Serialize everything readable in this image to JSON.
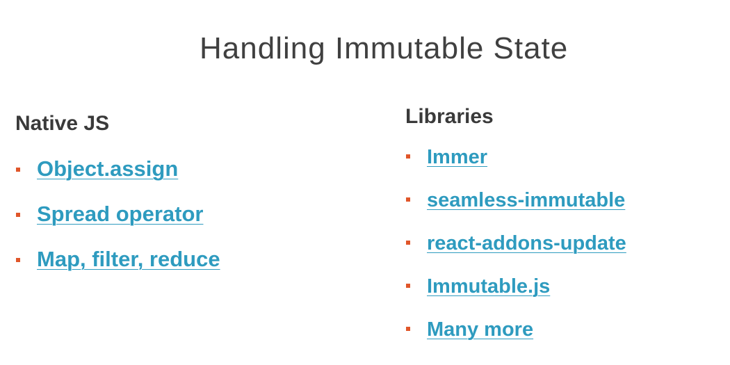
{
  "slide": {
    "title": "Handling Immutable State"
  },
  "native": {
    "heading": "Native JS",
    "items": [
      "Object.assign",
      "Spread operator",
      "Map, filter, reduce"
    ]
  },
  "libraries": {
    "heading": "Libraries",
    "items": [
      "Immer",
      "seamless-immutable",
      "react-addons-update",
      "Immutable.js",
      "Many more"
    ]
  },
  "colors": {
    "link": "#2e9bbf",
    "bullet": "#e0562a",
    "heading": "#3a3a3a",
    "title": "#404040"
  },
  "icons": {
    "bullet": "square-bullet-icon"
  }
}
